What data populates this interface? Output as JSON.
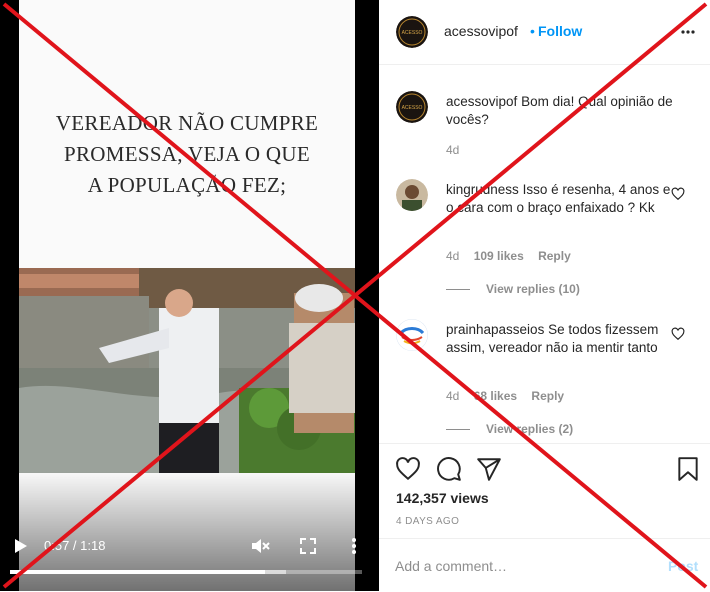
{
  "video": {
    "caption_lines": [
      "VEREADOR NÃO CUMPRE",
      "PROMESSA, VEJA O QUE",
      "A POPULAÇÃO FEZ;"
    ],
    "time": "0:57 / 1:18",
    "progress": 0.725,
    "buffered": 0.785
  },
  "header": {
    "username": "acessovipof",
    "dot": "•",
    "follow_label": "Follow",
    "avatar_text": "ACESSO"
  },
  "comments": [
    {
      "username": "acessovipof",
      "text": "Bom dia! Qual opinião de vocês?",
      "time": "4d"
    },
    {
      "username": "kingrudness",
      "text": "Isso é resenha, 4 anos e o cara com o braço enfaixado ? Kk",
      "time": "4d",
      "likes": "109 likes",
      "reply_label": "Reply",
      "view_replies": "View replies (10)"
    },
    {
      "username": "prainhapasseios",
      "text": "Se todos fizessem assim, vereador não ia mentir tanto",
      "time": "4d",
      "likes": "68 likes",
      "reply_label": "Reply",
      "view_replies": "View replies (2)"
    }
  ],
  "actions": {
    "views": "142,357 views",
    "date": "4 DAYS AGO"
  },
  "add_comment": {
    "placeholder": "Add a comment…",
    "post_label": "Post"
  },
  "colors": {
    "accent": "#0095f6",
    "overlay_x": "#e0141b"
  },
  "icons": [
    "play-icon",
    "mute-icon",
    "fullscreen-icon",
    "more-icon",
    "heart-icon",
    "comment-icon",
    "share-icon",
    "bookmark-icon"
  ]
}
